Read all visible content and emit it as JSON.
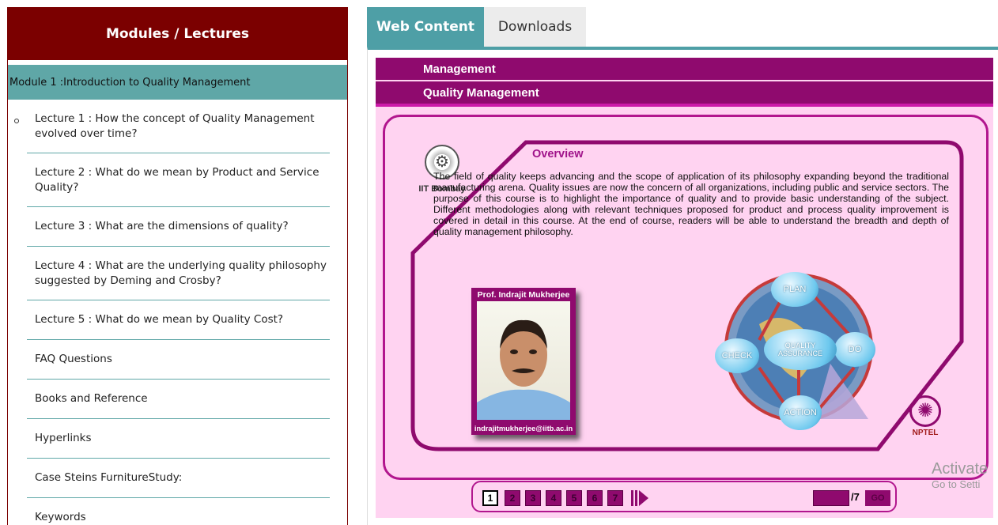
{
  "sidebar": {
    "header": "Modules / Lectures",
    "module_title": "Module 1 :Introduction to Quality Management",
    "items": [
      {
        "label": "Lecture 1 : How the concept of Quality Management evolved over time?"
      },
      {
        "label": "Lecture 2 : What do we mean by Product and Service Quality?"
      },
      {
        "label": "Lecture 3 : What are the dimensions of quality?"
      },
      {
        "label": "Lecture 4 : What are the underlying quality philosophy suggested by Deming and Crosby?"
      },
      {
        "label": "Lecture 5 : What do we mean by Quality Cost?"
      },
      {
        "label": "FAQ Questions"
      },
      {
        "label": "Books and Reference"
      },
      {
        "label": "Hyperlinks"
      },
      {
        "label": "Case Steins FurnitureStudy:"
      },
      {
        "label": "Keywords"
      }
    ]
  },
  "tabs": {
    "web_content": "Web Content",
    "downloads": "Downloads"
  },
  "slide": {
    "category": "Management",
    "course": "Quality Management",
    "logo_label": "IIT Bombay",
    "overview_title": "Overview",
    "overview_text": "The field of quality keeps advancing and the scope of application of its philosophy expanding beyond the traditional manufacturing arena. Quality issues are now the concern of all organizations, including public and service sectors. The purpose of this course is to highlight the importance of quality and to provide basic understanding of the subject. Different methodologies along with relevant techniques proposed for product and process quality improvement is covered in detail in this course. At the end of course, readers will be able to understand the breadth and depth of quality management philosophy.",
    "professor_name": "Prof. Indrajit Mukherjee",
    "professor_email": "indrajitmukherjee@iitb.ac.in",
    "cycle": {
      "plan": "PLAN",
      "do": "DO",
      "action": "ACTION",
      "check": "CHECK",
      "center": "QUALITY ASSURANCE"
    },
    "nptel_label": "NPTEL"
  },
  "pager": {
    "pages": [
      "1",
      "2",
      "3",
      "4",
      "5",
      "6",
      "7"
    ],
    "current": "1",
    "total": "/7",
    "go": "GO"
  },
  "watermark": {
    "line1": "Activate",
    "line2": "Go to Setti"
  },
  "colors": {
    "sidebar_header": "#7b0000",
    "module_bar": "#5fa7a7",
    "slide_bar": "#8f0a6e",
    "slide_bg": "#ffd3f1"
  }
}
